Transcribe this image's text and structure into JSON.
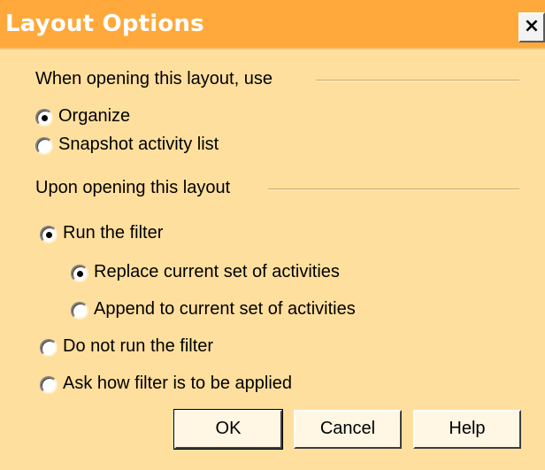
{
  "dialog": {
    "title": "Layout Options",
    "close_label": "×"
  },
  "open_with": {
    "heading": "When opening this layout, use",
    "options": [
      {
        "label": "Organize",
        "selected": true
      },
      {
        "label": "Snapshot activity list",
        "selected": false
      }
    ]
  },
  "upon_open": {
    "heading": "Upon opening this layout",
    "options": [
      {
        "label": "Run the filter",
        "selected": true
      },
      {
        "label": "Replace current set of activities",
        "selected": true
      },
      {
        "label": "Append to current set of activities",
        "selected": false
      },
      {
        "label": "Do not run the filter",
        "selected": false
      },
      {
        "label": "Ask how filter is to be applied",
        "selected": false
      }
    ]
  },
  "buttons": {
    "ok": "OK",
    "cancel": "Cancel",
    "help": "Help"
  },
  "colors": {
    "titlebar": "#ffa93c",
    "dialog_bg": "#ffdf9e"
  }
}
